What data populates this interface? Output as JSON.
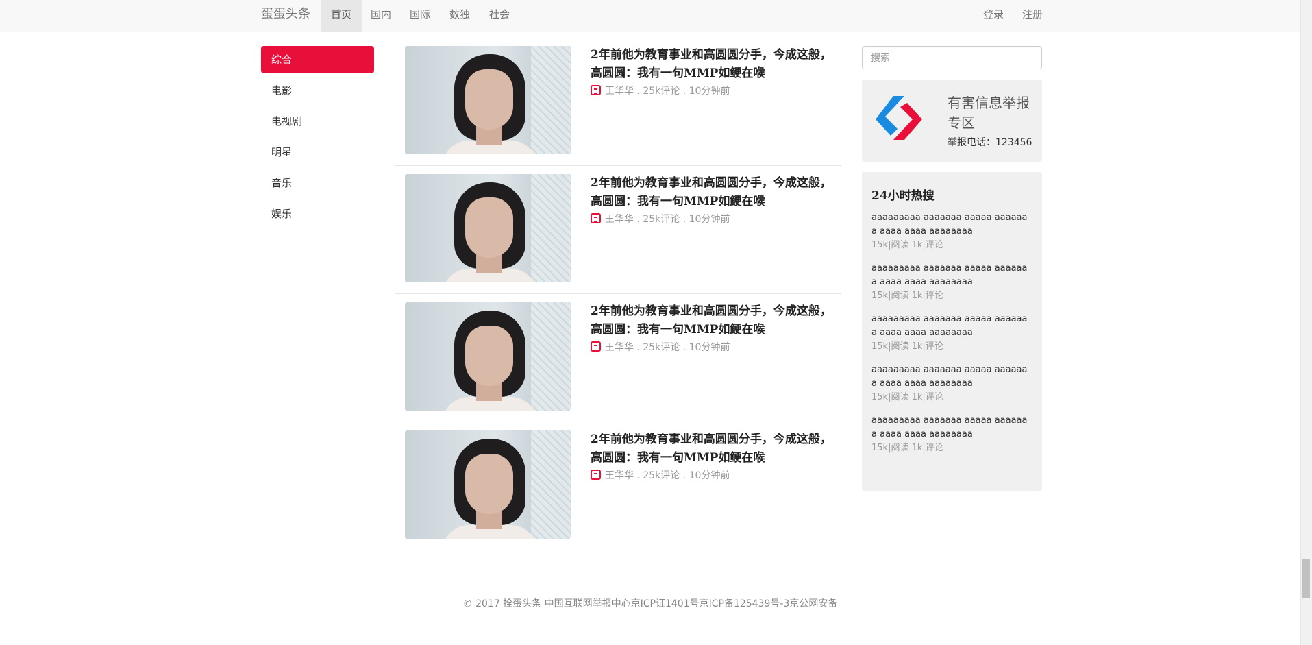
{
  "navbar": {
    "brand": "蛋蛋头条",
    "items": [
      {
        "label": "首页",
        "active": true
      },
      {
        "label": "国内",
        "active": false
      },
      {
        "label": "国际",
        "active": false
      },
      {
        "label": "数独",
        "active": false
      },
      {
        "label": "社会",
        "active": false
      }
    ],
    "login": "登录",
    "register": "注册"
  },
  "sidebar": {
    "items": [
      {
        "label": "综合",
        "active": true
      },
      {
        "label": "电影",
        "active": false
      },
      {
        "label": "电视剧",
        "active": false
      },
      {
        "label": "明星",
        "active": false
      },
      {
        "label": "音乐",
        "active": false
      },
      {
        "label": "娱乐",
        "active": false
      }
    ]
  },
  "news": [
    {
      "title": "2年前他为教育事业和高圆圆分手，今成这般，高圆圆：我有一句MMP如鲠在喉",
      "author": "王华华",
      "comments": "25k评论",
      "time": "10分钟前"
    },
    {
      "title": "2年前他为教育事业和高圆圆分手，今成这般，高圆圆：我有一句MMP如鲠在喉",
      "author": "王华华",
      "comments": "25k评论",
      "time": "10分钟前"
    },
    {
      "title": "2年前他为教育事业和高圆圆分手，今成这般，高圆圆：我有一句MMP如鲠在喉",
      "author": "王华华",
      "comments": "25k评论",
      "time": "10分钟前"
    },
    {
      "title": "2年前他为教育事业和高圆圆分手，今成这般，高圆圆：我有一句MMP如鲠在喉",
      "author": "王华华",
      "comments": "25k评论",
      "time": "10分钟前"
    }
  ],
  "search": {
    "placeholder": "搜索"
  },
  "report": {
    "title": "有害信息举报专区",
    "phone": "举报电话：123456"
  },
  "hot": {
    "title": "24小时热搜",
    "items": [
      {
        "text": "aaaaaaaaa aaaaaaa aaaaa aaaaaaa aaaa aaaa aaaaaaaa",
        "stats": "15k|阅读 1k|评论"
      },
      {
        "text": "aaaaaaaaa aaaaaaa aaaaa aaaaaaa aaaa aaaa aaaaaaaa",
        "stats": "15k|阅读 1k|评论"
      },
      {
        "text": "aaaaaaaaa aaaaaaa aaaaa aaaaaaa aaaa aaaa aaaaaaaa",
        "stats": "15k|阅读 1k|评论"
      },
      {
        "text": "aaaaaaaaa aaaaaaa aaaaa aaaaaaa aaaa aaaa aaaaaaaa",
        "stats": "15k|阅读 1k|评论"
      },
      {
        "text": "aaaaaaaaa aaaaaaa aaaaa aaaaaaa aaaa aaaa aaaaaaaa",
        "stats": "15k|阅读 1k|评论"
      }
    ]
  },
  "footer": {
    "text": "© 2017 拴蛋头条 中国互联网举报中心京ICP证1401号京ICP备125439号-3京公网安备"
  },
  "colors": {
    "accent": "#e8103a",
    "navbar_bg": "#f8f8f8",
    "panel_bg": "#f0f0f0"
  }
}
